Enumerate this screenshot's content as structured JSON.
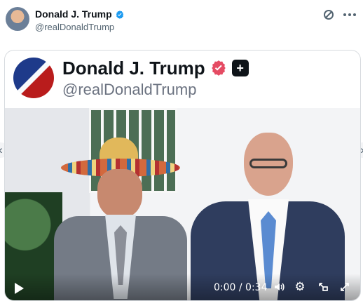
{
  "post": {
    "author_name": "Donald J. Trump",
    "author_handle": "@realDonaldTrump"
  },
  "overlay": {
    "author_name": "Donald J. Trump",
    "author_handle": "@realDonaldTrump"
  },
  "video": {
    "time": "0:00 / 0:34"
  },
  "icons": {
    "verified": "verified-badge-icon",
    "grok": "slash-circle-icon",
    "more": "more-icon",
    "play": "play-icon",
    "volume": "volume-icon",
    "settings": "gear-icon",
    "pip": "picture-in-picture-icon",
    "fullscreen": "fullscreen-icon"
  },
  "colors": {
    "verified": "#1d9bf0",
    "overlay_verified": "#e54b63",
    "text": "#0f1419",
    "muted": "#536471"
  }
}
